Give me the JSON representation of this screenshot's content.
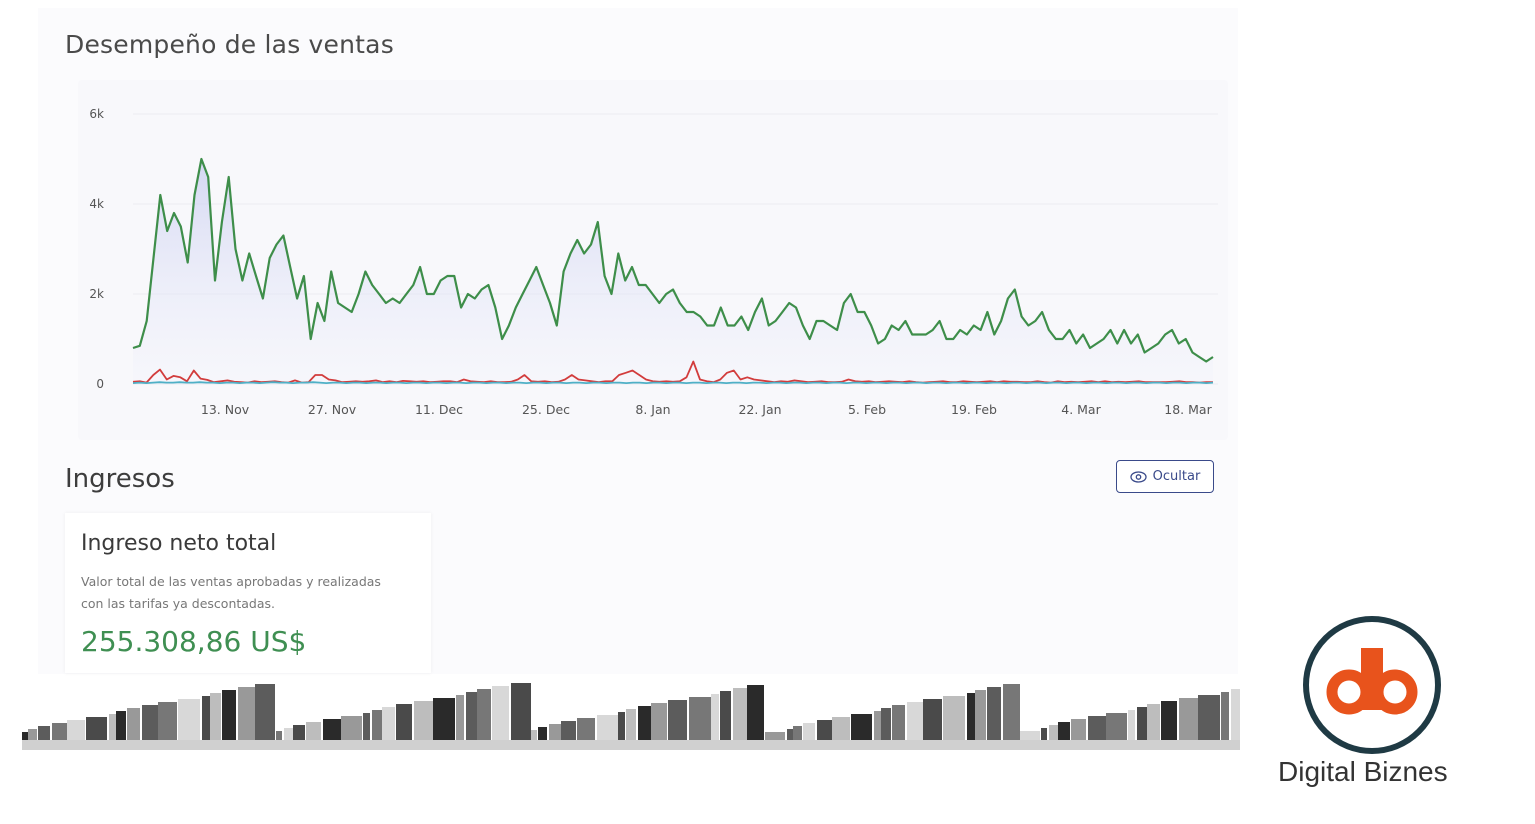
{
  "performance": {
    "title": "Desempeño de las ventas"
  },
  "chart_data": {
    "type": "line",
    "y_ticks": [
      "0",
      "2k",
      "4k",
      "6k"
    ],
    "ylim": [
      0,
      6000
    ],
    "x_ticks": [
      "13. Nov",
      "27. Nov",
      "11. Dec",
      "25. Dec",
      "8. Jan",
      "22. Jan",
      "5. Feb",
      "19. Feb",
      "4. Mar",
      "18. Mar"
    ],
    "grid": true,
    "series": [
      {
        "color": "#3e8e4a",
        "area": true,
        "values": [
          800,
          850,
          1400,
          2800,
          4200,
          3400,
          3800,
          3500,
          2700,
          4200,
          5000,
          4600,
          2300,
          3600,
          4600,
          3000,
          2300,
          2900,
          2400,
          1900,
          2800,
          3100,
          3300,
          2600,
          1900,
          2400,
          1000,
          1800,
          1400,
          2500,
          1800,
          1700,
          1600,
          2000,
          2500,
          2200,
          2000,
          1800,
          1900,
          1800,
          2000,
          2200,
          2600,
          2000,
          2000,
          2300,
          2400,
          2400,
          1700,
          2000,
          1900,
          2100,
          2200,
          1700,
          1000,
          1300,
          1700,
          2000,
          2300,
          2600,
          2200,
          1800,
          1300,
          2500,
          2900,
          3200,
          2900,
          3100,
          3600,
          2400,
          2000,
          2900,
          2300,
          2600,
          2200,
          2200,
          2000,
          1800,
          2000,
          2100,
          1800,
          1600,
          1600,
          1500,
          1300,
          1300,
          1700,
          1300,
          1300,
          1500,
          1200,
          1600,
          1900,
          1300,
          1400,
          1600,
          1800,
          1700,
          1300,
          1000,
          1400,
          1400,
          1300,
          1200,
          1800,
          2000,
          1600,
          1600,
          1300,
          900,
          1000,
          1300,
          1200,
          1400,
          1100,
          1100,
          1100,
          1200,
          1400,
          1000,
          1000,
          1200,
          1100,
          1300,
          1200,
          1600,
          1100,
          1400,
          1900,
          2100,
          1500,
          1300,
          1400,
          1600,
          1200,
          1000,
          1000,
          1200,
          900,
          1100,
          800,
          900,
          1000,
          1200,
          900,
          1200,
          900,
          1100,
          700,
          800,
          900,
          1100,
          1200,
          900,
          1000,
          700,
          600,
          500,
          600
        ],
        "y_offset": 0
      },
      {
        "color": "#d23c3c",
        "area": false,
        "values": [
          50,
          60,
          30,
          200,
          320,
          100,
          180,
          150,
          60,
          300,
          120,
          90,
          40,
          60,
          80,
          50,
          40,
          30,
          60,
          40,
          50,
          60,
          40,
          30,
          80,
          30,
          40,
          200,
          200,
          100,
          80,
          40,
          50,
          60,
          50,
          60,
          80,
          40,
          60,
          40,
          70,
          60,
          50,
          60,
          40,
          50,
          60,
          60,
          40,
          100,
          60,
          50,
          40,
          60,
          40,
          40,
          50,
          100,
          200,
          60,
          50,
          60,
          40,
          50,
          100,
          200,
          100,
          80,
          60,
          40,
          60,
          60,
          200,
          250,
          300,
          200,
          100,
          60,
          50,
          60,
          50,
          60,
          150,
          500,
          100,
          60,
          40,
          100,
          250,
          300,
          100,
          150,
          100,
          80,
          60,
          40,
          60,
          50,
          80,
          60,
          40,
          50,
          60,
          40,
          40,
          50,
          100,
          60,
          50,
          60,
          40,
          50,
          60,
          50,
          40,
          60,
          40,
          30,
          40,
          50,
          60,
          40,
          40,
          60,
          50,
          40,
          50,
          60,
          40,
          60,
          50,
          50,
          40,
          40,
          60,
          40,
          30,
          60,
          40,
          50,
          40,
          50,
          60,
          40,
          60,
          40,
          50,
          40,
          50,
          60,
          40,
          40,
          40,
          40,
          50,
          60,
          40,
          40,
          30,
          40,
          40
        ],
        "y_offset": 0
      },
      {
        "color": "#4fb0c6",
        "area": false,
        "values": [
          20,
          30,
          20,
          30,
          40,
          30,
          30,
          40,
          30,
          30,
          40,
          30,
          30,
          20,
          30,
          30,
          20,
          30,
          30,
          20,
          30,
          40,
          30,
          30,
          20,
          30,
          30,
          40,
          30,
          20,
          30,
          30,
          20,
          30,
          30,
          20,
          30,
          30,
          20,
          30,
          30,
          20,
          30,
          30,
          20,
          30,
          30,
          20,
          30,
          30,
          20,
          30,
          30,
          20,
          30,
          30,
          20,
          30,
          30,
          20,
          30,
          30,
          20,
          30,
          30,
          20,
          30,
          30,
          20,
          30,
          30,
          20,
          30,
          30,
          20,
          30,
          30,
          20,
          30,
          30,
          20,
          30,
          30,
          20,
          30,
          30,
          20,
          30,
          30,
          20,
          30,
          30,
          20,
          30,
          30,
          20,
          30,
          30,
          20,
          30,
          30,
          20,
          30,
          30,
          20,
          30,
          30,
          20,
          30,
          30,
          20,
          30,
          30,
          20,
          30,
          30,
          20,
          30,
          30,
          20,
          30,
          30,
          20,
          30,
          30,
          20,
          30,
          30,
          20,
          30,
          30,
          20,
          30,
          30,
          20,
          30,
          30,
          20,
          30,
          30,
          20,
          30,
          30,
          20,
          30,
          30,
          20,
          30,
          30,
          20,
          30,
          30,
          20,
          30,
          30,
          20,
          30,
          30,
          20,
          30,
          30,
          20,
          30
        ],
        "y_offset": 0
      }
    ]
  },
  "revenue": {
    "title": "Ingresos",
    "hide_label": "Ocultar",
    "hide_icon": "eye-icon",
    "card_title": "Ingreso neto total",
    "card_desc_line1": "Valor total de las ventas aprobadas y realizadas",
    "card_desc_line2": "con las tarifas ya descontadas.",
    "amount": "255.308,86 US$",
    "amount_color": "#3f8f52"
  },
  "brand": {
    "name": "Digital Biznes",
    "accent": "#e8531c",
    "ring": "#1f3a44"
  }
}
